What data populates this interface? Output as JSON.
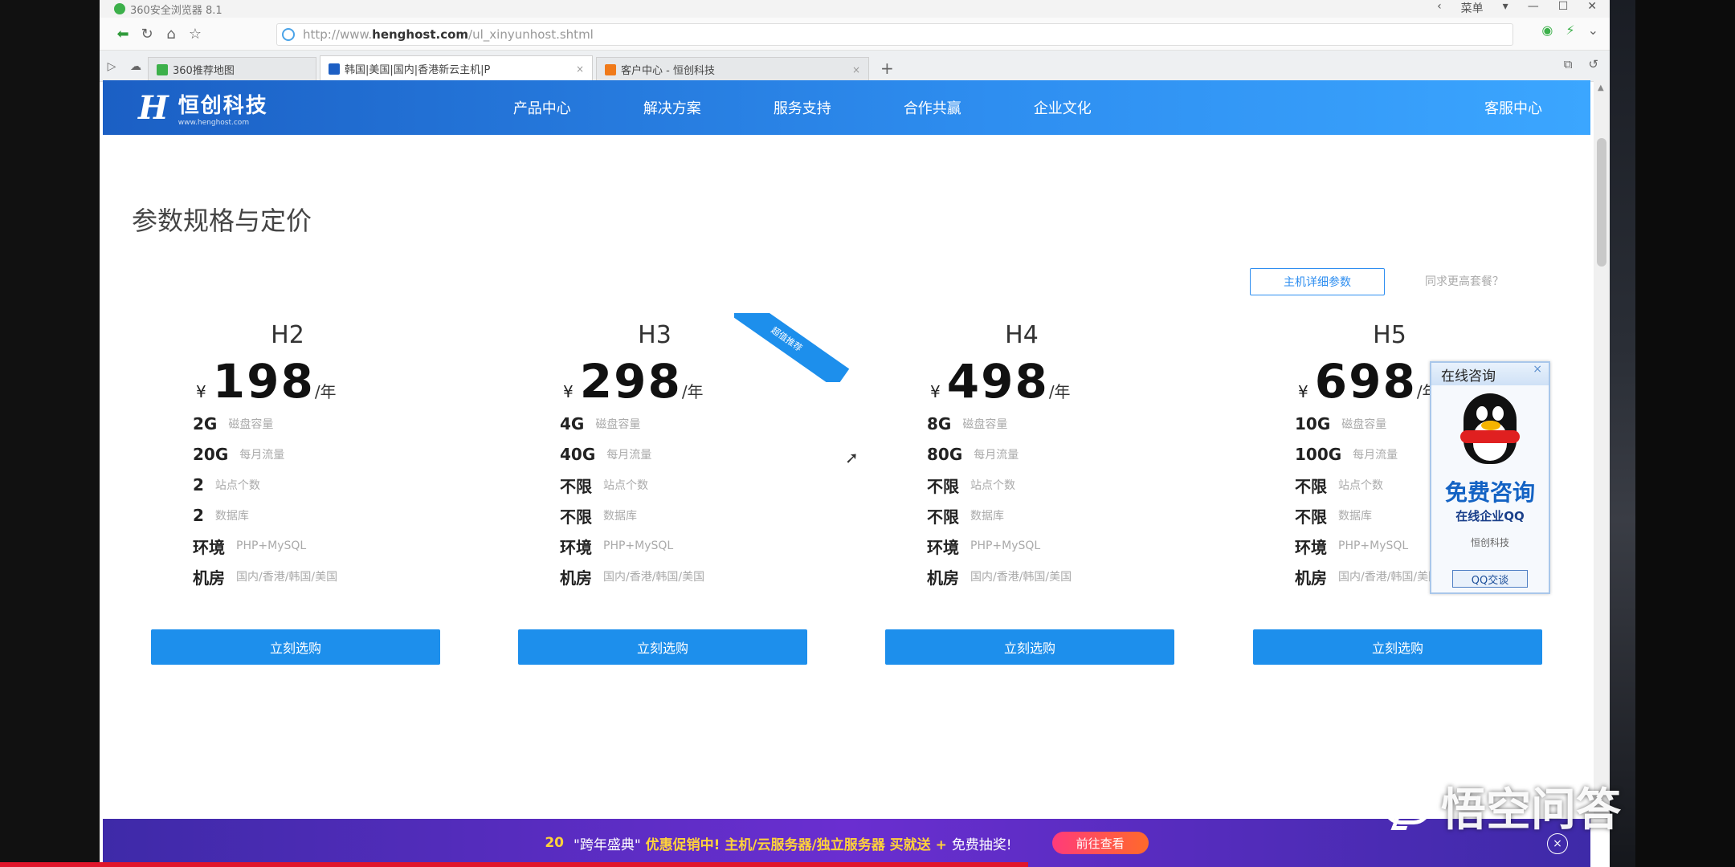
{
  "browser": {
    "app_title": "360安全浏览器 8.1",
    "window_buttons": [
      "‹",
      "菜单",
      "▾",
      "—",
      "☐",
      "✕"
    ],
    "url_prefix": "http://www.",
    "url_domain": "henghost.com",
    "url_path": "/ul_xinyunhost.shtml",
    "tabs": [
      {
        "label": "360推荐地图",
        "active": false
      },
      {
        "label": "韩国|美国|国内|香港新云主机|P",
        "active": true
      },
      {
        "label": "客户中心 - 恒创科技",
        "active": false
      }
    ]
  },
  "site": {
    "logo_cn": "恒创科技",
    "logo_en": "www.henghost.com",
    "nav": [
      "产品中心",
      "解决方案",
      "服务支持",
      "合作共赢",
      "企业文化"
    ],
    "service_center": "客服中心"
  },
  "section": {
    "title": "参数规格与定价",
    "detail_button": "主机详细参数",
    "compare_link": "同求更高套餐？",
    "ribbon": "超值推荐"
  },
  "plans": [
    {
      "name": "H2",
      "currency": "¥",
      "price": "198",
      "unit": "/年",
      "specs": [
        {
          "value": "2G",
          "label": "磁盘容量"
        },
        {
          "value": "20G",
          "label": "每月流量"
        },
        {
          "value": "2",
          "label": "站点个数"
        },
        {
          "value": "2",
          "label": "数据库"
        },
        {
          "value": "环境",
          "label": "PHP+MySQL"
        },
        {
          "value": "机房",
          "label": "国内/香港/韩国/美国"
        }
      ],
      "button": "立刻选购"
    },
    {
      "name": "H3",
      "currency": "¥",
      "price": "298",
      "unit": "/年",
      "specs": [
        {
          "value": "4G",
          "label": "磁盘容量"
        },
        {
          "value": "40G",
          "label": "每月流量"
        },
        {
          "value": "不限",
          "label": "站点个数"
        },
        {
          "value": "不限",
          "label": "数据库"
        },
        {
          "value": "环境",
          "label": "PHP+MySQL"
        },
        {
          "value": "机房",
          "label": "国内/香港/韩国/美国"
        }
      ],
      "button": "立刻选购"
    },
    {
      "name": "H4",
      "currency": "¥",
      "price": "498",
      "unit": "/年",
      "specs": [
        {
          "value": "8G",
          "label": "磁盘容量"
        },
        {
          "value": "80G",
          "label": "每月流量"
        },
        {
          "value": "不限",
          "label": "站点个数"
        },
        {
          "value": "不限",
          "label": "数据库"
        },
        {
          "value": "环境",
          "label": "PHP+MySQL"
        },
        {
          "value": "机房",
          "label": "国内/香港/韩国/美国"
        }
      ],
      "button": "立刻选购"
    },
    {
      "name": "H5",
      "currency": "¥",
      "price": "698",
      "unit": "/年",
      "specs": [
        {
          "value": "10G",
          "label": "磁盘容量"
        },
        {
          "value": "100G",
          "label": "每月流量"
        },
        {
          "value": "不限",
          "label": "站点个数"
        },
        {
          "value": "不限",
          "label": "数据库"
        },
        {
          "value": "环境",
          "label": "PHP+MySQL"
        },
        {
          "value": "机房",
          "label": "国内/香港/韩国/美国"
        }
      ],
      "button": "立刻选购"
    }
  ],
  "qq_panel": {
    "title": "在线咨询",
    "headline": "免费咨询",
    "subline": "在线企业QQ",
    "company": "恒创科技",
    "button": "QQ交谈"
  },
  "promo": {
    "badge": "20",
    "text_a": "\"跨年盛典\"",
    "text_b": "优惠促销中! 主机/云服务器/独立服务器 买就送 +",
    "text_c": "免费抽奖!",
    "button": "前往查看"
  },
  "watermark": "悟空问答",
  "colors": {
    "brand_blue": "#1d8fec",
    "header_start": "#1b5fc4",
    "promo_purple": "#4a2bb8"
  }
}
